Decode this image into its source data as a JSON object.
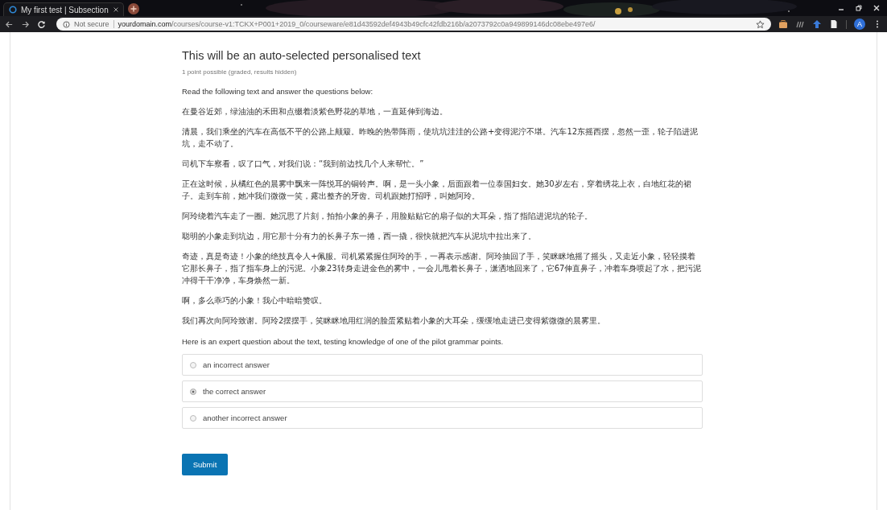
{
  "browser": {
    "tab": {
      "title": "My first test | Subsection",
      "selected": true
    },
    "security": "Not secure",
    "url_host": "yourdomain.com",
    "url_path": "/courses/course-v1:TCKX+P001+2019_0/courseware/e81d43592def4943b49cfc42fdb216b/a2073792c0a949899146dc08ebe497e6/",
    "profile": "A"
  },
  "problem": {
    "title": "This will be an auto-selected personalised text",
    "meta": "1 point possible (graded, results hidden)",
    "intro": "Read the following text and answer the questions below:",
    "paragraphs": [
      "在曼谷近郊，绿油油的禾田和点缀着淡紫色野花的草地，一直延伸到海边。",
      "清晨，我们乘坐的汽车在高低不平的公路上颠簸。昨晚的热带阵雨，使坑坑洼洼的公路+变得泥泞不堪。汽车12东摇西摆，忽然一歪，轮子陷进泥坑，走不动了。",
      "司机下车察看，叹了口气，对我们说：“我到前边找几个人来帮忙。”",
      "正在这时候，从橘红色的晨雾中飘来一阵悦耳的铜铃声。啊，是一头小象，后面跟着一位泰国妇女。她30岁左右，穿着绣花上衣，白地红花的裙子。走到车前，她冲我们微微一笑，露出整齐的牙齿。司机跟她打招呼，叫她阿玲。",
      "阿玲绕着汽车走了一圈。她沉思了片刻，拍拍小象的鼻子，用脸贴贴它的扇子似的大耳朵，指了指陷进泥坑的轮子。",
      "聪明的小象走到坑边，用它那十分有力的长鼻子东一捲，西一撬，很快就把汽车从泥坑中拉出来了。",
      "奇迹，真是奇迹！小象的绝技真令人+佩服。司机紧紧握住阿玲的手，一再表示感谢。阿玲抽回了手，笑眯眯地摇了摇头，又走近小象，轻轻摸着它那长鼻子，指了指车身上的污泥。小象23转身走进金色的雾中，一会儿甩着长鼻子，潇洒地回来了，它67伸直鼻子，冲着车身喷起了水，把污泥冲得干干净净，车身焕然一新。",
      "啊，多么乖巧的小象！我心中暗暗赞叹。",
      "我们再次向阿玲致谢。阿玲2摆摆手，笑眯眯地用红润的脸蛋紧贴着小象的大耳朵，缓缓地走进已变得紫微微的晨雾里。"
    ],
    "question": "Here is an expert question about the text, testing knowledge of one of the pilot grammar points.",
    "options": [
      {
        "label": "an incorrect answer",
        "selected": false
      },
      {
        "label": "the correct answer",
        "selected": true
      },
      {
        "label": "another incorrect answer",
        "selected": false
      }
    ],
    "submit": "Submit"
  }
}
